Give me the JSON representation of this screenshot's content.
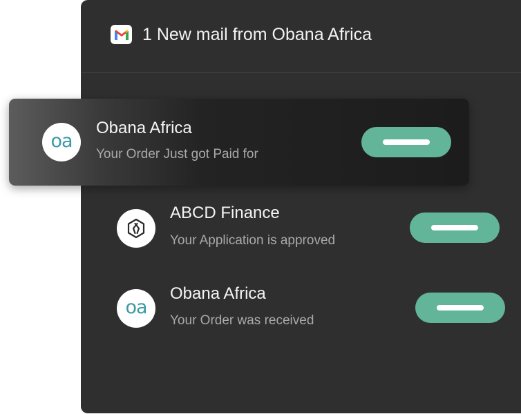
{
  "header": {
    "icon": "gmail-icon",
    "title": "1 New mail from Obana Africa"
  },
  "notifications": [
    {
      "avatar_text": "oa",
      "avatar_icon": "obana-africa-logo",
      "sender": "Obana Africa",
      "preview": "Your Order Just got Paid for",
      "highlighted": true
    },
    {
      "avatar_text": "",
      "avatar_icon": "abcd-finance-logo",
      "sender": "ABCD Finance",
      "preview": "Your Application is approved",
      "highlighted": false
    },
    {
      "avatar_text": "oa",
      "avatar_icon": "obana-africa-logo",
      "sender": "Obana Africa",
      "preview": "Your Order was received",
      "highlighted": false
    }
  ],
  "colors": {
    "panel_bg": "#2f2f2f",
    "accent_green": "#63b599",
    "logo_teal": "#3a9aa6"
  }
}
